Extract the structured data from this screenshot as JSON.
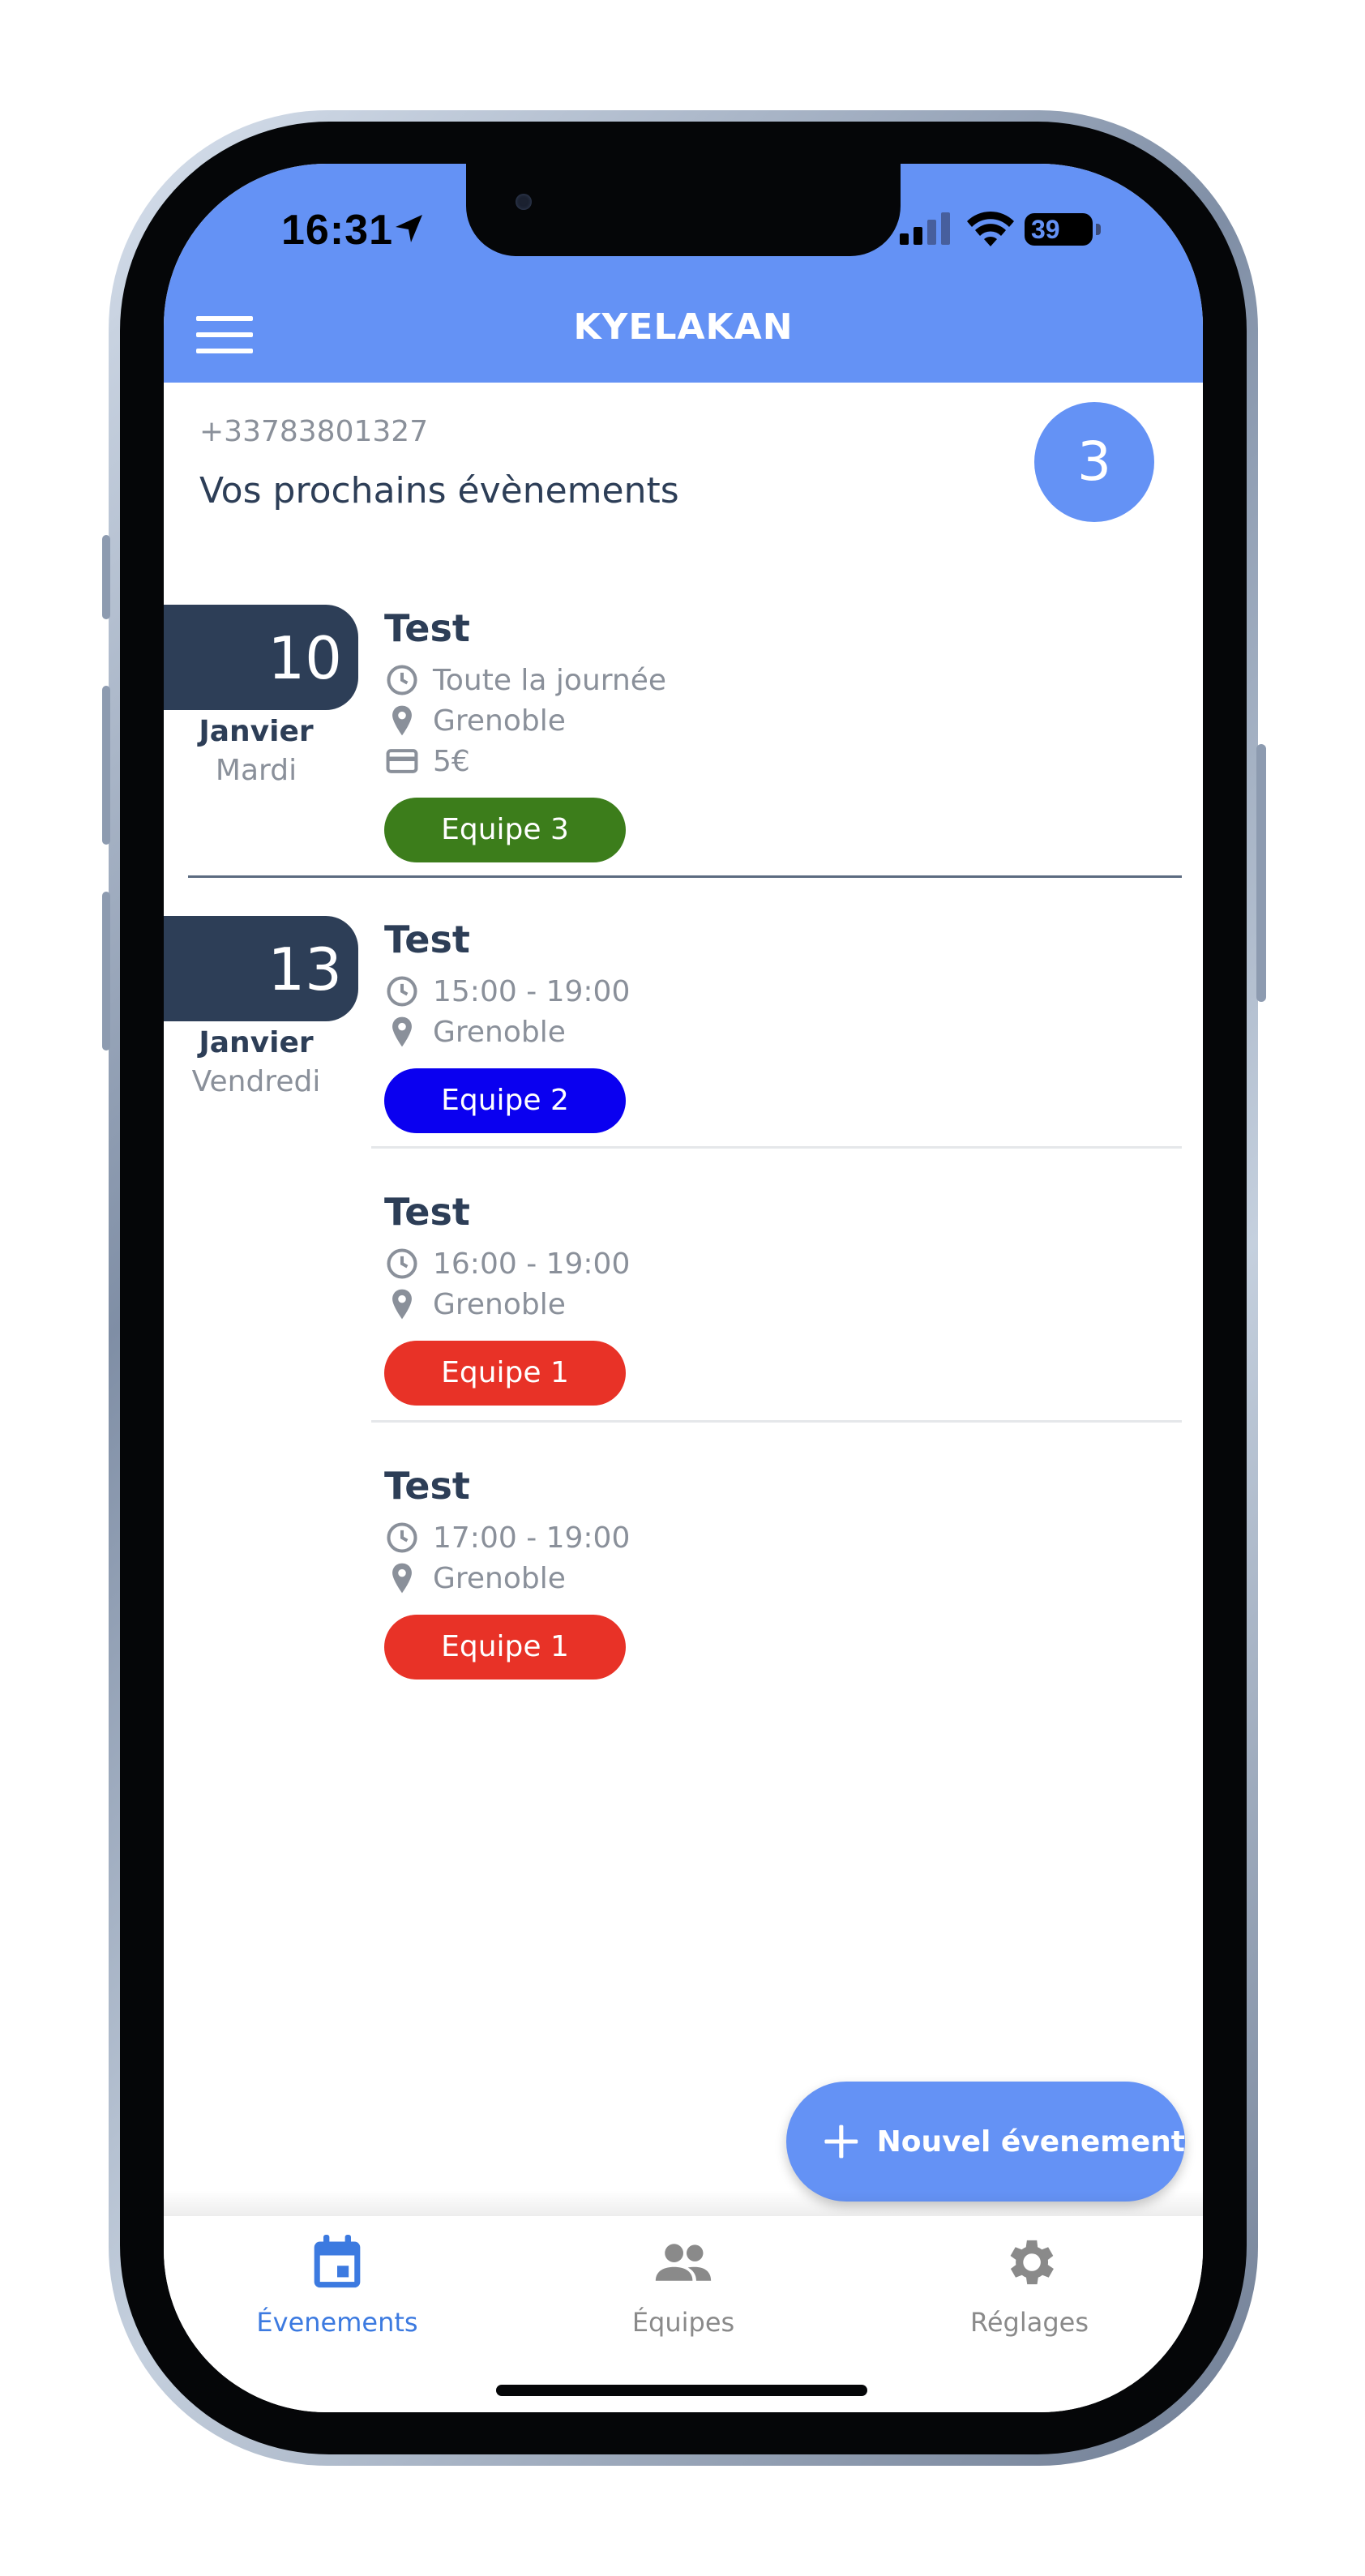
{
  "status_bar": {
    "time": "16:31",
    "battery": "39"
  },
  "header": {
    "title": "KYELAKAN"
  },
  "user": {
    "phone": "+33783801327"
  },
  "main": {
    "section_title": "Vos prochains évènements",
    "events_count": "3"
  },
  "days": [
    {
      "day_number": "10",
      "month": "Janvier",
      "weekday": "Mardi",
      "events": [
        {
          "title": "Test",
          "time": "Toute la journée",
          "location": "Grenoble",
          "price": "5€",
          "team": "Equipe 3",
          "team_color": "#3c7d1b"
        }
      ]
    },
    {
      "day_number": "13",
      "month": "Janvier",
      "weekday": "Vendredi",
      "events": [
        {
          "title": "Test",
          "time": "15:00 - 19:00",
          "location": "Grenoble",
          "team": "Equipe 2",
          "team_color": "#0a00f0"
        },
        {
          "title": "Test",
          "time": "16:00 - 19:00",
          "location": "Grenoble",
          "team": "Equipe 1",
          "team_color": "#e83227"
        },
        {
          "title": "Test",
          "time": "17:00 - 19:00",
          "location": "Grenoble",
          "team": "Equipe 1",
          "team_color": "#e83227"
        }
      ]
    }
  ],
  "fab": {
    "label": "Nouvel évenement"
  },
  "tabbar": {
    "items": [
      {
        "label": "Évenements",
        "icon": "calendar-icon",
        "active": true,
        "color": "#3c7ae0"
      },
      {
        "label": "Équipes",
        "icon": "people-icon",
        "active": false,
        "color": "#8a8a8a"
      },
      {
        "label": "Réglages",
        "icon": "gear-icon",
        "active": false,
        "color": "#8a8a8a"
      }
    ]
  },
  "colors": {
    "primary": "#6492f5",
    "dark": "#2d3e57",
    "muted": "#8a909a"
  }
}
